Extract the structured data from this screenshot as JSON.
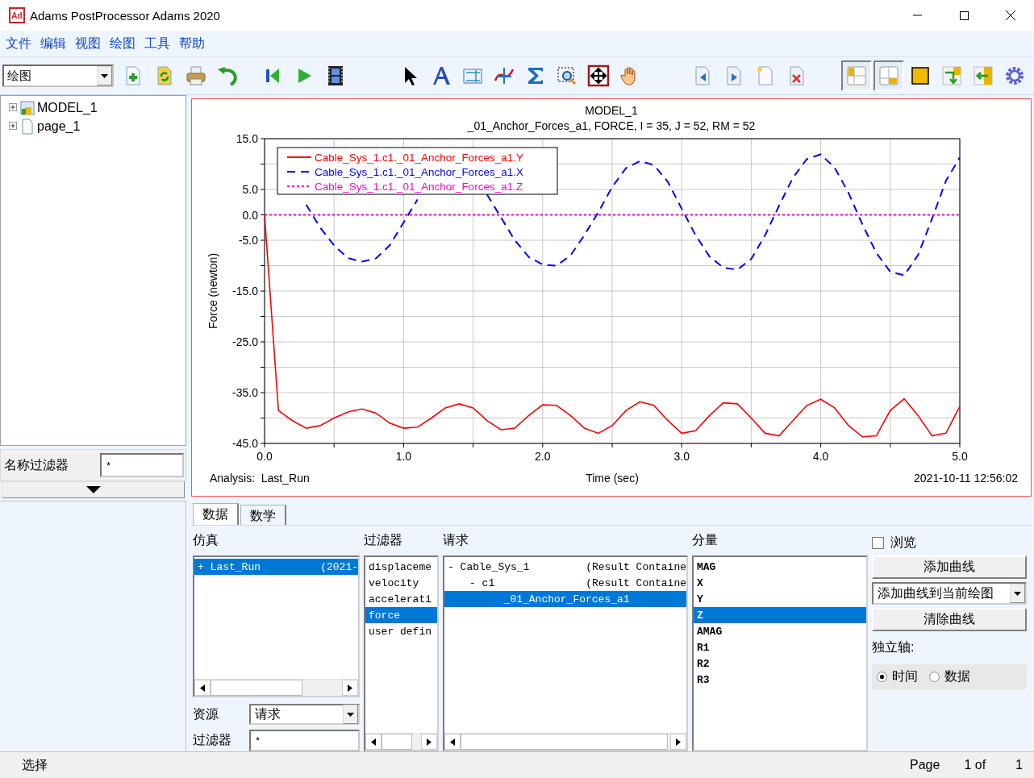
{
  "window": {
    "app_icon": "Ad",
    "title": "Adams PostProcessor Adams 2020"
  },
  "menu": [
    "文件",
    "编辑",
    "视图",
    "绘图",
    "工具",
    "帮助"
  ],
  "toolbar": {
    "mode": "绘图",
    "layout_toggles": [
      {
        "selected": true
      },
      {
        "selected": true
      }
    ]
  },
  "tree": [
    {
      "label": "MODEL_1",
      "kind": "model",
      "expanded": false
    },
    {
      "label": "page_1",
      "kind": "page",
      "expanded": false
    }
  ],
  "name_filter": {
    "label": "名称过滤器",
    "value": "*"
  },
  "plot": {
    "subtitle": "_01_Anchor_Forces_a1, FORCE, I = 35, J = 52, RM = 52",
    "analysis": "Analysis:  Last_Run",
    "timestamp": "2021-10-11 12:56:02",
    "chart_data": {
      "type": "line",
      "title": "MODEL_1",
      "grid": true,
      "legend": "upper left",
      "xlabel": "Time (sec)",
      "ylabel": "Force (newton)",
      "xlim": [
        0,
        5
      ],
      "ylim": [
        -45,
        15
      ],
      "xticks": [
        {
          "value": 0,
          "label": "0.0"
        },
        {
          "value": 1,
          "label": "1.0"
        },
        {
          "value": 2,
          "label": "2.0"
        },
        {
          "value": 3,
          "label": "3.0"
        },
        {
          "value": 4,
          "label": "4.0"
        },
        {
          "value": 5,
          "label": "5.0"
        }
      ],
      "yticks": [
        {
          "value": 15,
          "label": "15.0"
        },
        {
          "value": 5,
          "label": "5.0"
        },
        {
          "value": 0,
          "label": "0.0"
        },
        {
          "value": -5,
          "label": "-5.0"
        },
        {
          "value": -15,
          "label": "-15.0"
        },
        {
          "value": -25,
          "label": "-25.0"
        },
        {
          "value": -35,
          "label": "-35.0"
        },
        {
          "value": -45,
          "label": "-45.0"
        }
      ],
      "x": [
        0,
        0.1,
        0.2,
        0.3,
        0.4,
        0.5,
        0.6,
        0.7,
        0.8,
        0.9,
        1.0,
        1.1,
        1.2,
        1.3,
        1.4,
        1.5,
        1.6,
        1.7,
        1.8,
        1.9,
        2.0,
        2.1,
        2.2,
        2.3,
        2.4,
        2.5,
        2.6,
        2.7,
        2.8,
        2.9,
        3.0,
        3.1,
        3.2,
        3.3,
        3.4,
        3.5,
        3.6,
        3.7,
        3.8,
        3.9,
        4.0,
        4.1,
        4.2,
        4.3,
        4.4,
        4.5,
        4.6,
        4.7,
        4.8,
        4.9,
        5.0
      ],
      "series": [
        {
          "name": "Cable_Sys_1.c1._01_Anchor_Forces_a1.Y",
          "color": "#ff0000",
          "line_style": "solid",
          "values": [
            0,
            -38.5,
            -40.5,
            -42.0,
            -41.5,
            -40.0,
            -38.8,
            -38.2,
            -39.0,
            -41.0,
            -42.0,
            -41.8,
            -40.0,
            -38.0,
            -37.2,
            -38.0,
            -40.5,
            -42.3,
            -42.0,
            -39.5,
            -37.4,
            -37.5,
            -39.5,
            -42.0,
            -43.0,
            -41.5,
            -38.5,
            -36.8,
            -37.5,
            -40.5,
            -43.0,
            -42.5,
            -39.5,
            -37.0,
            -37.2,
            -40.0,
            -43.0,
            -43.5,
            -40.5,
            -37.5,
            -36.3,
            -38.0,
            -41.5,
            -43.7,
            -43.5,
            -38.5,
            -36.2,
            -39.5,
            -43.5,
            -43.0,
            -37.7
          ]
        },
        {
          "name": "Cable_Sys_1.c1._01_Anchor_Forces_a1.X",
          "color": "#0000ff",
          "line_style": "dashed",
          "values": [
            null,
            null,
            null,
            2.0,
            -2.5,
            -6.0,
            -8.5,
            -9.2,
            -8.6,
            -6.0,
            -1.5,
            3.0,
            null,
            null,
            null,
            null,
            4.0,
            -0.5,
            -5.0,
            -8.3,
            -9.8,
            -10.0,
            -8.0,
            -4.0,
            0.5,
            5.5,
            9.2,
            10.6,
            9.8,
            6.5,
            1.2,
            -4.0,
            -8.2,
            -10.4,
            -10.8,
            -8.7,
            -4.0,
            1.8,
            7.3,
            11.0,
            11.9,
            9.3,
            4.3,
            -1.9,
            -7.5,
            -11.2,
            -11.9,
            -7.9,
            -0.8,
            6.7,
            11.3
          ]
        },
        {
          "name": "Cable_Sys_1.c1._01_Anchor_Forces_a1.Z",
          "color": "#ff00cc",
          "line_style": "dotted",
          "values": [
            0,
            0,
            0,
            0,
            0,
            0,
            0,
            0,
            0,
            0,
            0,
            0,
            0,
            0,
            0,
            0,
            0,
            0,
            0,
            0,
            0,
            0,
            0,
            0,
            0,
            0,
            0,
            0,
            0,
            0,
            0,
            0,
            0,
            0,
            0,
            0,
            0,
            0,
            0,
            0,
            0,
            0,
            0,
            0,
            0,
            0,
            0,
            0,
            0,
            0,
            0
          ]
        }
      ]
    }
  },
  "tabs": [
    {
      "label": "数据",
      "selected": true
    },
    {
      "label": "数学",
      "selected": false
    }
  ],
  "simulation": {
    "label": "仿真",
    "rows": [
      {
        "name": "+ Last_Run",
        "info": "(2021-",
        "selected": true
      }
    ]
  },
  "source": {
    "label": "资源",
    "value": "请求"
  },
  "sim_filter": {
    "label": "过滤器",
    "value": "*"
  },
  "filter": {
    "label": "过滤器",
    "items": [
      {
        "label": "displaceme",
        "selected": false
      },
      {
        "label": "velocity",
        "selected": false
      },
      {
        "label": "accelerati",
        "selected": false
      },
      {
        "label": "force",
        "selected": true
      },
      {
        "label": "user defin",
        "selected": false
      }
    ]
  },
  "request": {
    "label": "请求",
    "items": [
      {
        "toggle": "-",
        "label": "Cable_Sys_1",
        "info": "(Result Containe",
        "selected": false,
        "children": [
          {
            "toggle": "-",
            "label": "c1",
            "info": "(Result Containe",
            "selected": false,
            "children": [
              {
                "label": "_01_Anchor_Forces_a1",
                "selected": true
              }
            ]
          }
        ]
      }
    ]
  },
  "component": {
    "label": "分量",
    "items": [
      {
        "label": "MAG",
        "selected": false
      },
      {
        "label": "X",
        "selected": false
      },
      {
        "label": "Y",
        "selected": false
      },
      {
        "label": "Z",
        "selected": true
      },
      {
        "label": "AMAG",
        "selected": false
      },
      {
        "label": "R1",
        "selected": false
      },
      {
        "label": "R2",
        "selected": false
      },
      {
        "label": "R3",
        "selected": false
      }
    ]
  },
  "browse": {
    "label": "浏览",
    "checked": false
  },
  "add_curve": "添加曲线",
  "add_mode": "添加曲线到当前绘图",
  "clear_curves": "清除曲线",
  "axis": {
    "label": "独立轴:",
    "options": [
      {
        "label": "时间",
        "selected": true
      },
      {
        "label": "数据",
        "selected": false
      }
    ]
  },
  "status": {
    "text": "选择",
    "page_label": "Page",
    "page_text": "1 of",
    "page_total": "1"
  }
}
